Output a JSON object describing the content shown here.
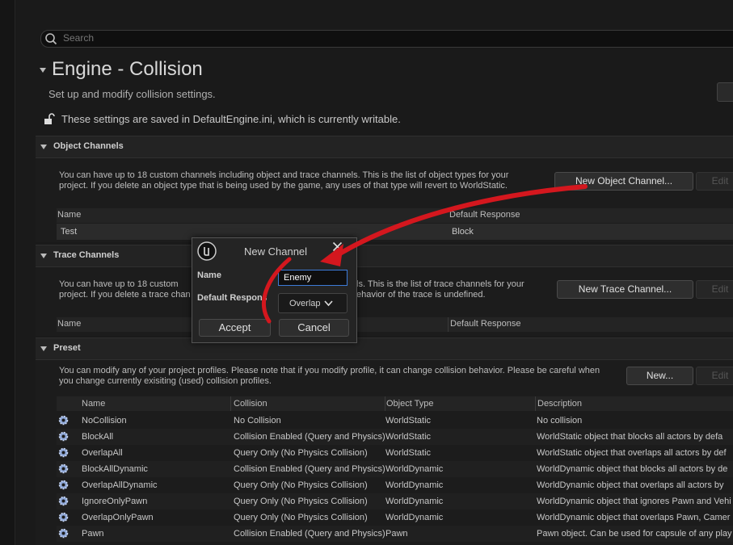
{
  "search": {
    "placeholder": "Search"
  },
  "page": {
    "title": "Engine - Collision",
    "subtitle": "Set up and modify collision settings.",
    "saved_note": "These settings are saved in DefaultEngine.ini, which is currently writable."
  },
  "object_channels": {
    "label": "Object Channels",
    "description_line1": "You can have up to 18 custom channels including object and trace channels. This is the list of object types for your",
    "description_line2": "project. If you delete an object type that is being used by the game, any uses of that type will revert to WorldStatic.",
    "new_button": "New Object Channel...",
    "edit_button": "Edit",
    "headers": {
      "name": "Name",
      "default_response": "Default Response"
    },
    "rows": [
      {
        "name": "Test",
        "default_response": "Block"
      }
    ]
  },
  "trace_channels": {
    "label": "Trace Channels",
    "description_line1a": "You can have up to 18 custom",
    "description_line1b": "ls. This is the list of trace channels for your",
    "description_line2a": "project. If you delete a trace chan",
    "description_line2b": "ehavior of the trace is undefined.",
    "new_button": "New Trace Channel...",
    "edit_button": "Edit",
    "headers": {
      "name": "Name",
      "default_response": "Default Response"
    }
  },
  "preset": {
    "label": "Preset",
    "description_line1": "You can modify any of your project profiles. Please note that if you modify profile, it can change collision behavior. Please be careful when",
    "description_line2": "you change currently exisiting (used) collision profiles.",
    "new_button": "New...",
    "edit_button": "Edit",
    "headers": {
      "name": "Name",
      "collision": "Collision",
      "object_type": "Object Type",
      "description": "Description"
    },
    "rows": [
      {
        "name": "NoCollision",
        "collision": "No Collision",
        "object_type": "WorldStatic",
        "description": "No collision"
      },
      {
        "name": "BlockAll",
        "collision": "Collision Enabled (Query and Physics)",
        "object_type": "WorldStatic",
        "description": "WorldStatic object that blocks all actors by defa"
      },
      {
        "name": "OverlapAll",
        "collision": "Query Only (No Physics Collision)",
        "object_type": "WorldStatic",
        "description": "WorldStatic object that overlaps all actors by def"
      },
      {
        "name": "BlockAllDynamic",
        "collision": "Collision Enabled (Query and Physics)",
        "object_type": "WorldDynamic",
        "description": "WorldDynamic object that blocks all actors by de"
      },
      {
        "name": "OverlapAllDynamic",
        "collision": "Query Only (No Physics Collision)",
        "object_type": "WorldDynamic",
        "description": "WorldDynamic object that overlaps all actors by"
      },
      {
        "name": "IgnoreOnlyPawn",
        "collision": "Query Only (No Physics Collision)",
        "object_type": "WorldDynamic",
        "description": "WorldDynamic object that ignores Pawn and Vehi"
      },
      {
        "name": "OverlapOnlyPawn",
        "collision": "Query Only (No Physics Collision)",
        "object_type": "WorldDynamic",
        "description": "WorldDynamic object that overlaps Pawn, Camer"
      },
      {
        "name": "Pawn",
        "collision": "Collision Enabled (Query and Physics)",
        "object_type": "Pawn",
        "description": "Pawn object. Can be used for capsule of any play"
      }
    ]
  },
  "dialog": {
    "title": "New Channel",
    "name_label": "Name",
    "name_value": "Enemy",
    "default_response_label": "Default Respons",
    "default_response_value": "Overlap",
    "accept_button": "Accept",
    "cancel_button": "Cancel"
  },
  "colors": {
    "annotation": "#d4171e",
    "input_focus": "#3d7bd8",
    "background": "#1a1a1a"
  },
  "icons": [
    "search-icon",
    "unlock-icon",
    "collapse-arrow-icon",
    "unreal-logo-icon",
    "close-icon",
    "chevron-down-icon",
    "gear-icon"
  ]
}
